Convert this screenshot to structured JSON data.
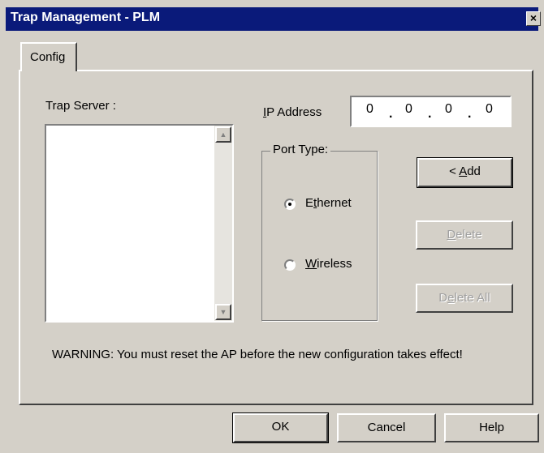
{
  "window": {
    "title": "Trap Management - PLM",
    "close_glyph": "×"
  },
  "tabs": [
    {
      "label": "Config"
    }
  ],
  "trap_server": {
    "label": "Trap Server :",
    "items": []
  },
  "ip_address": {
    "label": "IP Address",
    "octets": [
      "0",
      "0",
      "0",
      "0"
    ]
  },
  "port_type": {
    "label": "Port Type:",
    "options": [
      {
        "label": "Ethernet",
        "selected": true
      },
      {
        "label": "Wireless",
        "selected": false
      }
    ]
  },
  "buttons": {
    "add": "< Add",
    "delete": "Delete",
    "delete_all": "Delete All"
  },
  "warning": "WARNING: You must reset the AP before the new configuration takes effect!",
  "footer": {
    "ok": "OK",
    "cancel": "Cancel",
    "help": "Help"
  }
}
